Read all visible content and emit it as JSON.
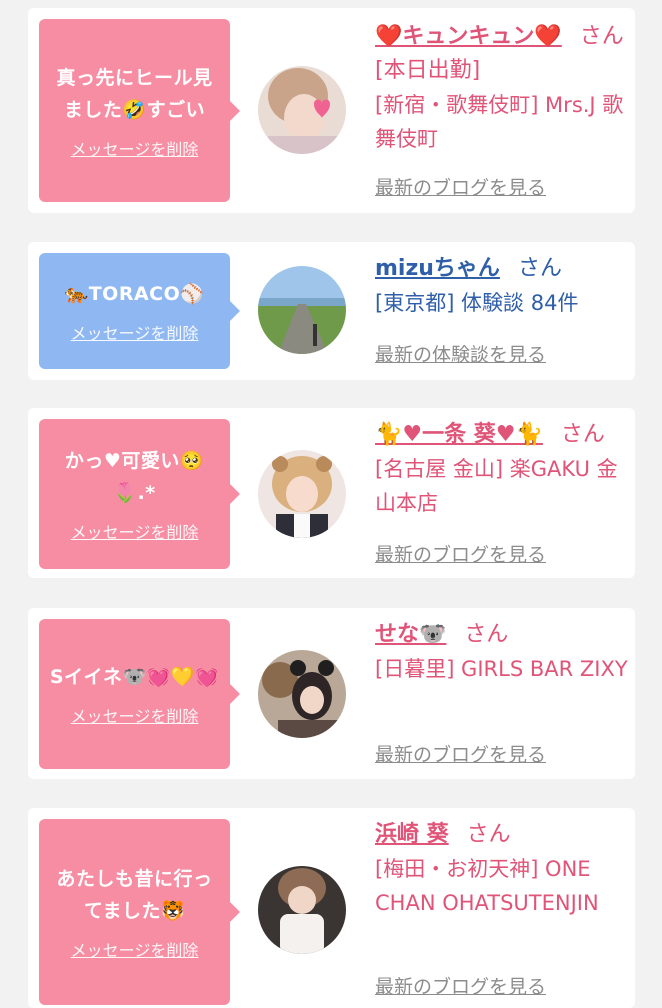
{
  "items": [
    {
      "message": "真っ先にヒール見ました🤣すごい",
      "delete_label": "メッセージを削除",
      "name": "❤️キュンキュン❤️",
      "honorific": "さん",
      "status": "[本日出勤]",
      "shop": "[新宿・歌舞伎町] Mrs.J 歌舞伎町",
      "link": "最新のブログを見る",
      "avatar": "woman-photo-heart-sticker"
    },
    {
      "message": "🐅TORACO⚾️",
      "delete_label": "メッセージを削除",
      "name": "mizuちゃん",
      "honorific": "さん",
      "shop": "[東京都] 体験談 84件",
      "link": "最新の体験談を見る",
      "avatar": "road-landscape-photo"
    },
    {
      "message": "かっ♥可愛い🥺🌷.*",
      "delete_label": "メッセージを削除",
      "name": "🐈♥一条 葵♥🐈",
      "honorific": "さん",
      "shop": "[名古屋 金山] 楽GAKU 金山本店",
      "link": "最新のブログを見る",
      "avatar": "woman-photo-bear-filter"
    },
    {
      "message": "Sイイネ🐨💓💛💓",
      "delete_label": "メッセージを削除",
      "name": "せな🐨",
      "honorific": "さん",
      "shop": "[日暮里] GIRLS BAR ZIXY",
      "link": "最新のブログを見る",
      "avatar": "woman-photo-ears"
    },
    {
      "message": "あたしも昔に行ってました🐯",
      "delete_label": "メッセージを削除",
      "name": "浜崎 葵",
      "honorific": "さん",
      "shop": "[梅田・お初天神] ONE CHAN OHATSUTENJIN",
      "link": "最新のブログを見る",
      "avatar": "woman-photo-white-top"
    }
  ]
}
